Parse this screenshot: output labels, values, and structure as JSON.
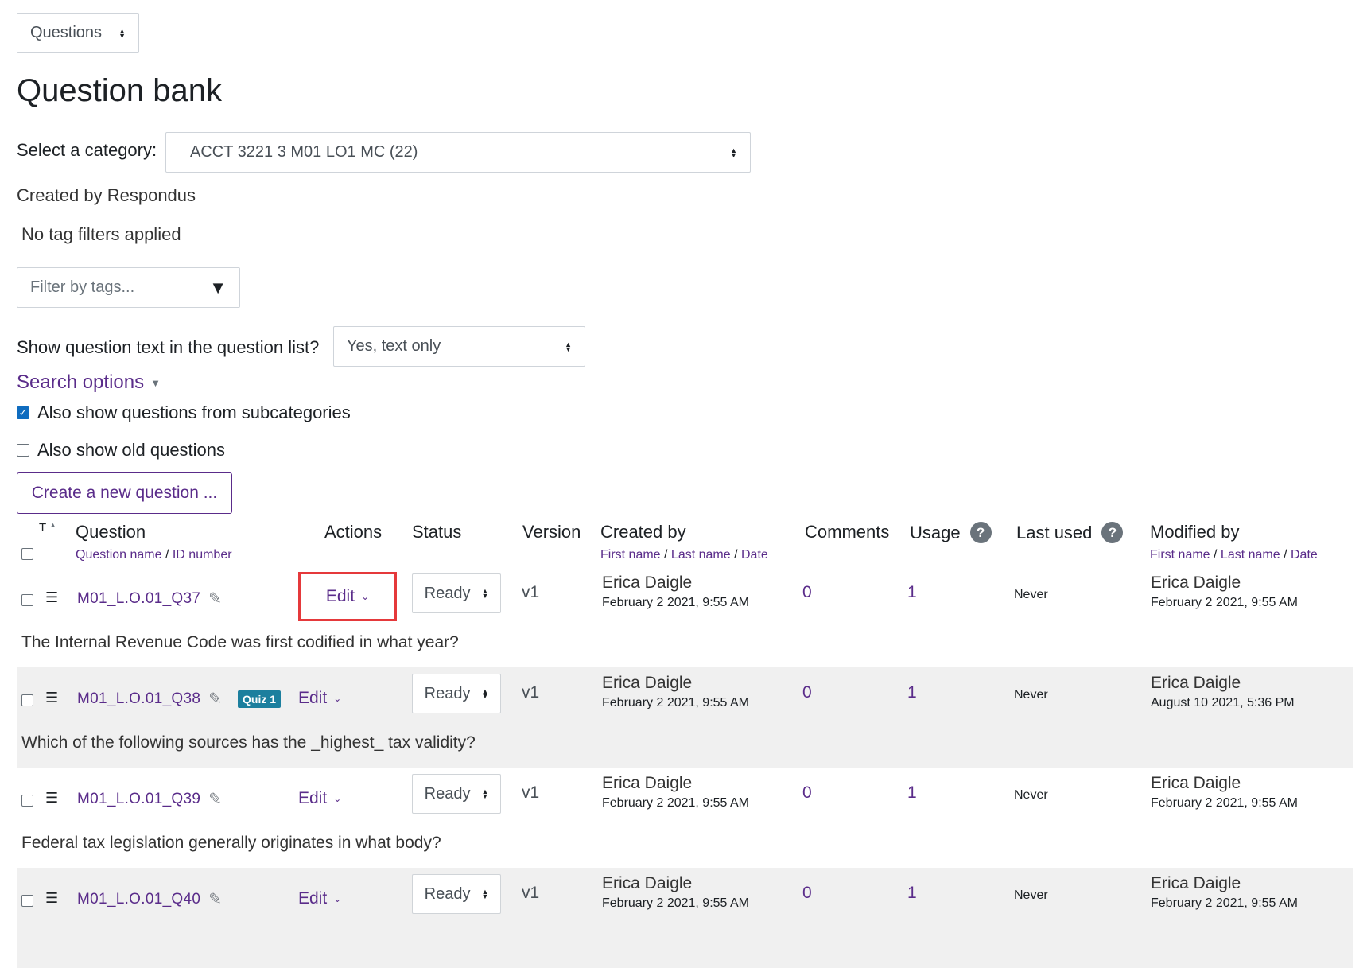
{
  "top_select": {
    "value": "Questions"
  },
  "page_title": "Question bank",
  "category": {
    "label": "Select a category:",
    "value": "ACCT 3221 3 M01 LO1 MC (22)"
  },
  "category_info": "Created by Respondus",
  "tag_status": "No tag filters applied",
  "tag_filter": {
    "placeholder": "Filter by tags..."
  },
  "show_text": {
    "label": "Show question text in the question list?",
    "value": "Yes, text only"
  },
  "search_options": {
    "label": "Search options"
  },
  "subcategories": {
    "label": "Also show questions from subcategories",
    "checked": true
  },
  "old_questions": {
    "label": "Also show old questions",
    "checked": false
  },
  "create_button": {
    "label": "Create a new question ..."
  },
  "table": {
    "headers": {
      "t": "T",
      "question": "Question",
      "question_sub_name": "Question name",
      "question_sub_sep": " / ",
      "question_sub_id": "ID number",
      "actions": "Actions",
      "status": "Status",
      "version": "Version",
      "created_by": "Created by",
      "created_first": "First name",
      "created_last": "Last name",
      "created_date": "Date",
      "comments": "Comments",
      "usage": "Usage",
      "last_used": "Last used",
      "modified_by": "Modified by",
      "modified_first": "First name",
      "modified_last": "Last name",
      "modified_date": "Date",
      "sep": " / "
    },
    "rows": [
      {
        "name": "M01_L.O.01_Q37",
        "badge": "",
        "action": "Edit",
        "status": "Ready",
        "version": "v1",
        "created_name": "Erica Daigle",
        "created_date": "February 2 2021, 9:55 AM",
        "comments": "0",
        "usage": "1",
        "last_used": "Never",
        "modified_name": "Erica Daigle",
        "modified_date": "February 2 2021, 9:55 AM",
        "text": "The Internal Revenue Code was first codified in what year?"
      },
      {
        "name": "M01_L.O.01_Q38",
        "badge": "Quiz 1",
        "action": "Edit",
        "status": "Ready",
        "version": "v1",
        "created_name": "Erica Daigle",
        "created_date": "February 2 2021, 9:55 AM",
        "comments": "0",
        "usage": "1",
        "last_used": "Never",
        "modified_name": "Erica Daigle",
        "modified_date": "August 10 2021, 5:36 PM",
        "text": "Which of the following sources has the _highest_ tax validity?"
      },
      {
        "name": "M01_L.O.01_Q39",
        "badge": "",
        "action": "Edit",
        "status": "Ready",
        "version": "v1",
        "created_name": "Erica Daigle",
        "created_date": "February 2 2021, 9:55 AM",
        "comments": "0",
        "usage": "1",
        "last_used": "Never",
        "modified_name": "Erica Daigle",
        "modified_date": "February 2 2021, 9:55 AM",
        "text": "Federal tax legislation generally originates in what body?"
      },
      {
        "name": "M01_L.O.01_Q40",
        "badge": "",
        "action": "Edit",
        "status": "Ready",
        "version": "v1",
        "created_name": "Erica Daigle",
        "created_date": "February 2 2021, 9:55 AM",
        "comments": "0",
        "usage": "1",
        "last_used": "Never",
        "modified_name": "Erica Daigle",
        "modified_date": "February 2 2021, 9:55 AM",
        "text": ""
      }
    ]
  },
  "colors": {
    "link": "#5a2c8a",
    "highlight_border": "#e5393b",
    "badge_bg": "#1c7f9e",
    "checkbox_checked": "#0f6cbf"
  }
}
